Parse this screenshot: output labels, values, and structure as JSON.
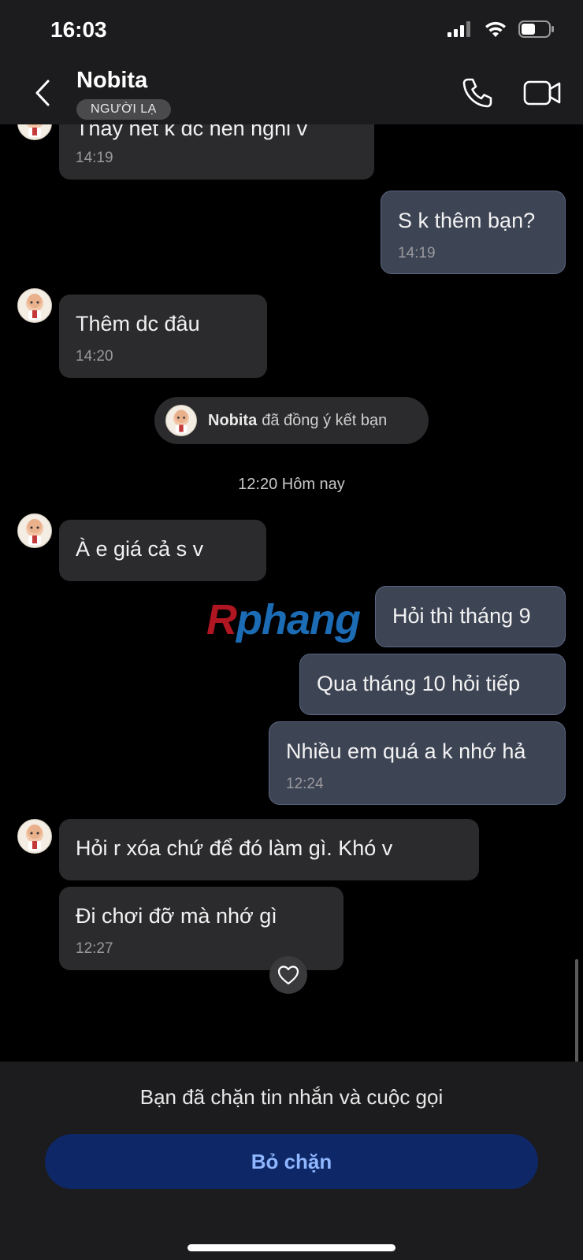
{
  "status_bar": {
    "time": "16:03"
  },
  "header": {
    "contact_name": "Nobita",
    "badge": "NGƯỜI LẠ"
  },
  "messages": [
    {
      "dir": "in",
      "text": "Thấy hết k dc nên nghỉ v",
      "time": "14:19"
    },
    {
      "dir": "out",
      "text": "S k thêm bạn?",
      "time": "14:19"
    },
    {
      "dir": "in",
      "text": "Thêm dc đâu",
      "time": "14:20"
    },
    {
      "dir": "out",
      "text": "Hỏi thì tháng 9",
      "time": ""
    },
    {
      "dir": "out",
      "text": "Qua tháng 10 hỏi tiếp",
      "time": ""
    },
    {
      "dir": "out",
      "text": "Nhiều em quá a k nhớ hả",
      "time": "12:24"
    },
    {
      "dir": "in",
      "text": "À e giá cả s v",
      "time": ""
    },
    {
      "dir": "in",
      "text": "Hỏi r xóa chứ để đó làm gì. Khó v",
      "time": ""
    },
    {
      "dir": "in",
      "text": "Đi chơi đỡ mà nhớ gì",
      "time": "12:27"
    }
  ],
  "system_notice": {
    "name": "Nobita",
    "text": "đã đồng ý kết bạn"
  },
  "time_separator": "12:20 Hôm nay",
  "watermark": {
    "first": "R",
    "rest": "phang"
  },
  "footer": {
    "blocked_text": "Bạn đã chặn tin nhắn và cuộc gọi",
    "unblock_label": "Bỏ chặn"
  },
  "colors": {
    "incoming_bubble": "#2b2b2d",
    "outgoing_bubble": "#3d4454",
    "unblock_button": "#0e2766",
    "unblock_text": "#8fb6ff"
  }
}
